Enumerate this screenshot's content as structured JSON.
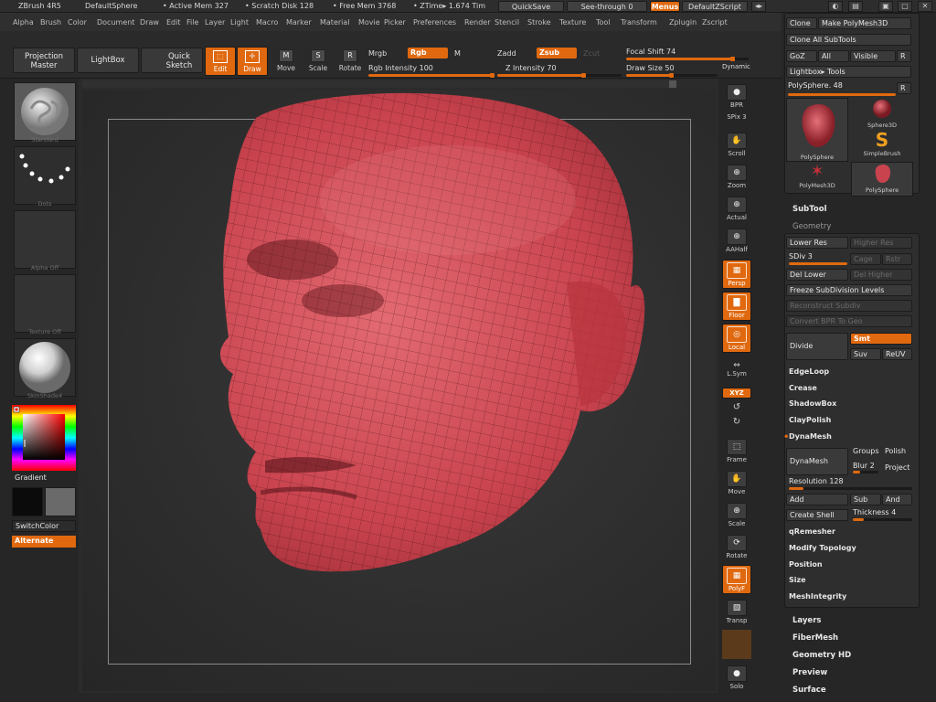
{
  "titlebar": {
    "app": "ZBrush 4R5",
    "doc": "DefaultSphere",
    "active_mem": "• Active Mem 327",
    "scratch": "• Scratch Disk 128",
    "free_mem": "• Free Mem 3768",
    "ztime": "• ZTime▸ 1.674 Tim",
    "quicksave": "QuickSave",
    "seethrough": "See-through  0",
    "menus": "Menus",
    "script": "DefaultZScript",
    "win_buttons": [
      "◂▸",
      "◐",
      "▤",
      "▣",
      "▢",
      "✕"
    ]
  },
  "menu": [
    "Alpha",
    "Brush",
    "Color",
    "Document",
    "Draw",
    "Edit",
    "File",
    "Layer",
    "Light",
    "Macro",
    "Marker",
    "Material",
    "Movie",
    "Picker",
    "Preferences",
    "Render",
    "Stencil",
    "Stroke",
    "Texture",
    "Tool",
    "Transform",
    "Zplugin",
    "Zscript"
  ],
  "shelf": {
    "projection_master": "Projection\nMaster",
    "lightbox": "LightBox",
    "quick_sketch": "Quick\nSketch",
    "edit": "Edit",
    "draw": "Draw",
    "move": "Move",
    "scale": "Scale",
    "rotate": "Rotate",
    "mrgb": "Mrgb",
    "rgb": "Rgb",
    "m": "M",
    "rgb_intensity": "Rgb Intensity 100",
    "rgb_intensity_value": 1.0,
    "zadd": "Zadd",
    "zsub": "Zsub",
    "zcut": "Zcut",
    "z_intensity": "Z Intensity 70",
    "z_intensity_value": 0.7,
    "focal_shift": "Focal Shift 74",
    "focal_shift_value": 0.87,
    "draw_size": "Draw Size 50",
    "draw_size_value": 0.5,
    "dynamic": "Dynamic"
  },
  "left": {
    "brush_label": "Standard",
    "stroke_label": "Dots",
    "alpha_label": "Alpha Off",
    "texture_label": "Texture Off",
    "material_label": "SkinShade4",
    "gradient": "Gradient",
    "switchcolor": "SwitchColor",
    "alternate": "Alternate",
    "colors": {
      "main": "#0b0b0b",
      "secondary": "#6a6a6a"
    }
  },
  "right_tools": [
    {
      "icon": "●",
      "label": "BPR"
    },
    {
      "icon": "",
      "label": "SPix 3"
    },
    {
      "icon": "✋",
      "label": "Scroll"
    },
    {
      "icon": "⊕",
      "label": "Zoom"
    },
    {
      "icon": "⊕",
      "label": "Actual"
    },
    {
      "icon": "⊕",
      "label": "AAHalf"
    },
    {
      "icon": "▦",
      "label": "Persp"
    },
    {
      "icon": "▇",
      "label": "Floor"
    },
    {
      "icon": "◎",
      "label": "Local"
    },
    {
      "icon": "⇔",
      "label": "L.Sym"
    },
    {
      "icon": "",
      "label": "XYZ"
    },
    {
      "icon": "↺",
      "label": ""
    },
    {
      "icon": "↻",
      "label": ""
    },
    {
      "icon": "⬚",
      "label": "Frame"
    },
    {
      "icon": "✋",
      "label": "Move"
    },
    {
      "icon": "⊕",
      "label": "Scale"
    },
    {
      "icon": "⟳",
      "label": "Rotate"
    },
    {
      "icon": "▦",
      "label": "PolyF"
    },
    {
      "icon": "▧",
      "label": "Transp"
    },
    {
      "icon": "",
      "label": ""
    },
    {
      "icon": "●",
      "label": "Solo"
    }
  ],
  "panel": {
    "clone": "Clone",
    "make_polymesh": "Make PolyMesh3D",
    "clone_all": "Clone All SubTools",
    "goz": "GoZ",
    "all": "All",
    "visible": "Visible",
    "r": "R",
    "lightbox_tools": "Lightbox▸ Tools",
    "polysphere": "PolySphere. 48",
    "tools": [
      {
        "label": "PolySphere"
      },
      {
        "label": "Sphere3D"
      },
      {
        "label": "SimpleBrush"
      },
      {
        "label": "PolyMesh3D"
      },
      {
        "label": "PolySphere"
      }
    ],
    "subtool": "SubTool",
    "geometry": "Geometry",
    "lower_res": "Lower Res",
    "higher_res": "Higher Res",
    "sdiv": "SDiv 3",
    "cage": "Cage",
    "rstr": "Rstr",
    "del_lower": "Del Lower",
    "del_higher": "Del Higher",
    "freeze": "Freeze SubDivision Levels",
    "reconstruct": "Reconstruct Subdiv",
    "convert": "Convert BPR To Geo",
    "divide": "Divide",
    "smt": "Smt",
    "suv": "Suv",
    "reuv": "ReUV",
    "edgeloop": "EdgeLoop",
    "crease": "Crease",
    "shadowbox": "ShadowBox",
    "claypolish": "ClayPolish",
    "dynamesh_head": "DynaMesh",
    "dynamesh": "DynaMesh",
    "groups": "Groups",
    "polish": "Polish",
    "blur": "Blur 2",
    "project": "Project",
    "resolution": "Resolution 128",
    "add": "Add",
    "sub": "Sub",
    "and": "And",
    "create_shell": "Create Shell",
    "thickness": "Thickness 4",
    "qremesher": "qRemesher",
    "modify_topology": "Modify Topology",
    "position": "Position",
    "size": "Size",
    "meshintegrity": "MeshIntegrity",
    "layers": "Layers",
    "fibermesh": "FiberMesh",
    "geometry_hd": "Geometry HD",
    "preview": "Preview",
    "surface": "Surface"
  }
}
